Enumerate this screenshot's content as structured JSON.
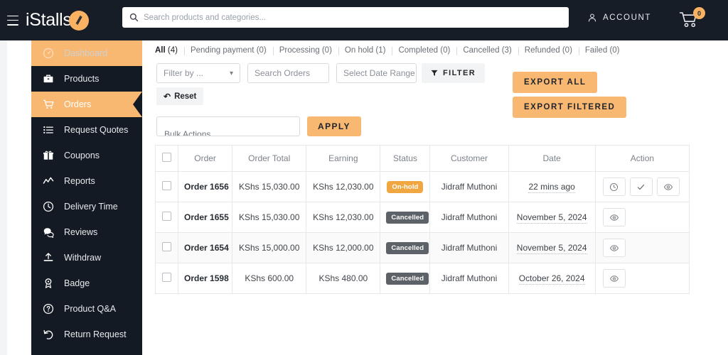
{
  "header": {
    "menu_icon": "hamburger-icon",
    "brand": "iStalls",
    "search": {
      "placeholder": "Search products and categories...",
      "value": "",
      "icon": "search-icon"
    },
    "account_label": "ACCOUNT",
    "account_icon": "user-icon",
    "cart_icon": "cart-icon",
    "cart_count": "0"
  },
  "sidebar": {
    "items": [
      {
        "label": "Dashboard",
        "icon": "dashboard-icon",
        "state": "dimmed"
      },
      {
        "label": "Products",
        "icon": "briefcase-icon",
        "state": "normal"
      },
      {
        "label": "Orders",
        "icon": "cart-icon",
        "state": "active"
      },
      {
        "label": "Request Quotes",
        "icon": "list-icon",
        "state": "normal"
      },
      {
        "label": "Coupons",
        "icon": "gift-icon",
        "state": "normal"
      },
      {
        "label": "Reports",
        "icon": "chart-line-icon",
        "state": "normal"
      },
      {
        "label": "Delivery Time",
        "icon": "clock-icon",
        "state": "normal"
      },
      {
        "label": "Reviews",
        "icon": "comments-icon",
        "state": "normal"
      },
      {
        "label": "Withdraw",
        "icon": "upload-icon",
        "state": "normal"
      },
      {
        "label": "Badge",
        "icon": "award-icon",
        "state": "normal"
      },
      {
        "label": "Product Q&A",
        "icon": "question-circle-icon",
        "state": "normal"
      },
      {
        "label": "Return Request",
        "icon": "undo-icon",
        "state": "normal"
      }
    ]
  },
  "tabs": [
    {
      "label": "All",
      "count": "(4)",
      "current": true
    },
    {
      "label": "Pending payment",
      "count": "(0)",
      "current": false
    },
    {
      "label": "Processing",
      "count": "(0)",
      "current": false
    },
    {
      "label": "On hold",
      "count": "(1)",
      "current": false
    },
    {
      "label": "Completed",
      "count": "(0)",
      "current": false
    },
    {
      "label": "Cancelled",
      "count": "(3)",
      "current": false
    },
    {
      "label": "Refunded",
      "count": "(0)",
      "current": false
    },
    {
      "label": "Failed",
      "count": "(0)",
      "current": false
    }
  ],
  "filters": {
    "filter_by_label": "Filter by ...",
    "chevron_icon": "chevron-down-icon",
    "search_order_placeholder": "Search Orders",
    "search_order_value": "",
    "date_placeholder": "Select Date Range",
    "date_value": "",
    "filter_button": "FILTER",
    "filter_icon": "funnel-icon",
    "reset_button": "Reset",
    "reset_icon": "undo-icon",
    "export_all": "EXPORT ALL",
    "export_filtered": "EXPORT FILTERED"
  },
  "bulk": {
    "select_label": "Bulk Actions",
    "apply_button": "APPLY"
  },
  "table": {
    "columns": [
      "",
      "Order",
      "Order Total",
      "Earning",
      "Status",
      "Customer",
      "Date",
      "Action"
    ],
    "rows": [
      {
        "order": "Order 1656",
        "total": "KShs 15,030.00",
        "earning": "KShs 12,030.00",
        "status": "On-hold",
        "status_type": "onhold",
        "customer": "Jidraff Muthoni",
        "date": "22 mins ago",
        "actions": [
          "clock-icon",
          "check-icon",
          "eye-icon"
        ]
      },
      {
        "order": "Order 1655",
        "total": "KShs 15,030.00",
        "earning": "KShs 12,030.00",
        "status": "Cancelled",
        "status_type": "cancelled",
        "customer": "Jidraff Muthoni",
        "date": "November 5, 2024",
        "actions": [
          "eye-icon"
        ]
      },
      {
        "order": "Order 1654",
        "total": "KShs 15,000.00",
        "earning": "KShs 12,000.00",
        "status": "Cancelled",
        "status_type": "cancelled",
        "customer": "Jidraff Muthoni",
        "date": "November 5, 2024",
        "actions": [
          "eye-icon"
        ]
      },
      {
        "order": "Order 1598",
        "total": "KShs 600.00",
        "earning": "KShs 480.00",
        "status": "Cancelled",
        "status_type": "cancelled",
        "customer": "Jidraff Muthoni",
        "date": "October 26, 2024",
        "actions": [
          "eye-icon"
        ]
      }
    ]
  },
  "colors": {
    "accent": "#f9b872",
    "sidebar_bg": "#131a23",
    "topbar_bg": "#161d26",
    "status_onhold": "#f0a742",
    "status_cancelled": "#5d6168"
  }
}
